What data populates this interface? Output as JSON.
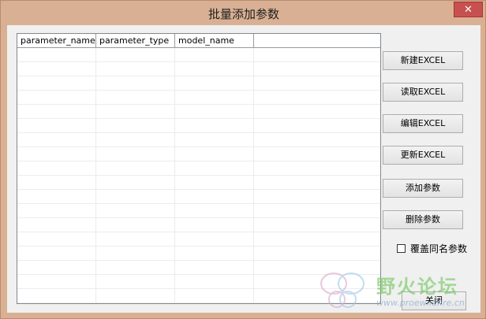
{
  "window": {
    "title": "批量添加参数",
    "close_glyph": "✕"
  },
  "table": {
    "columns": [
      "parameter_name",
      "parameter_type",
      "model_name"
    ]
  },
  "buttons": {
    "new_excel": "新建EXCEL",
    "read_excel": "读取EXCEL",
    "edit_excel": "编辑EXCEL",
    "update_excel": "更新EXCEL",
    "add_params": "添加参数",
    "delete_params": "删除参数",
    "close": "关闭"
  },
  "overwrite_checkbox": {
    "label": "覆盖同名参数",
    "checked": false
  },
  "watermark": {
    "text": "野火论坛",
    "url": "www.proewildfire.cn"
  }
}
